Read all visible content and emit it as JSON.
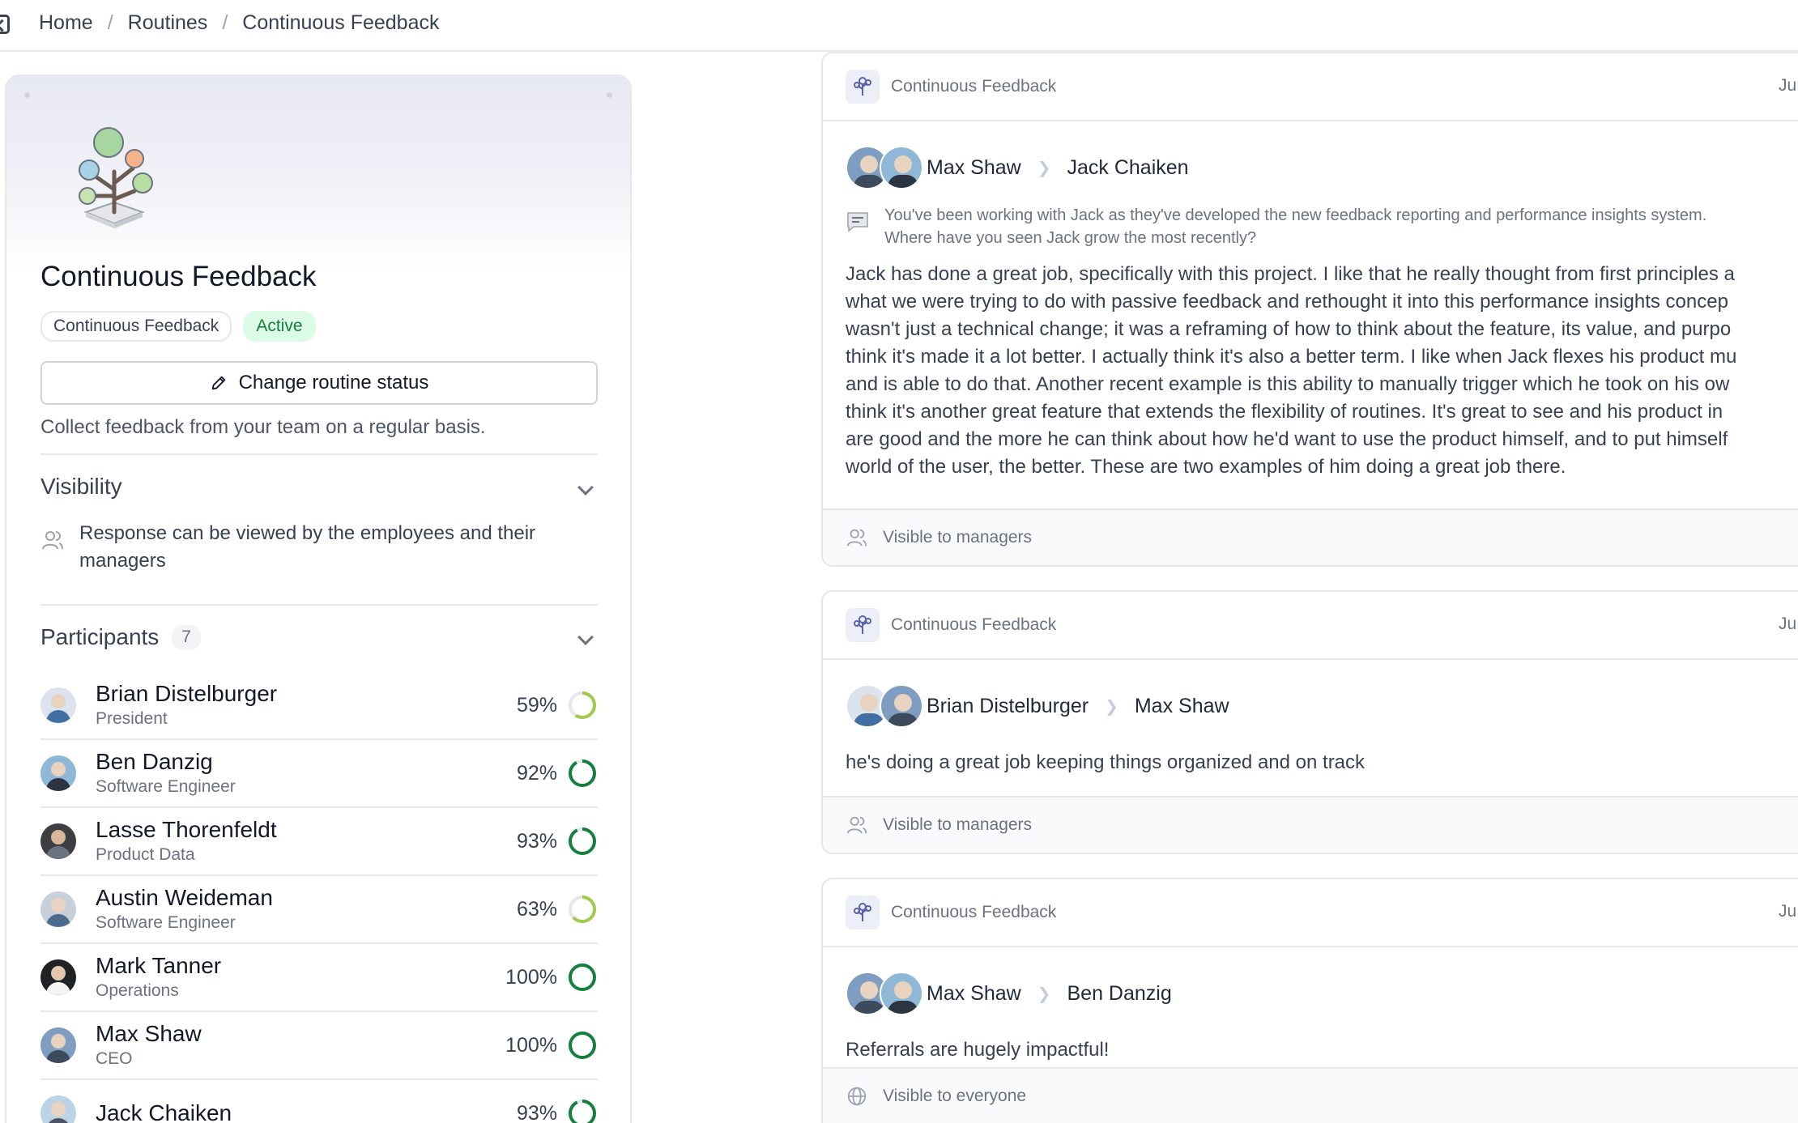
{
  "breadcrumb": {
    "items": [
      "Home",
      "Routines",
      "Continuous Feedback"
    ],
    "separator": "/"
  },
  "routine": {
    "title": "Continuous Feedback",
    "tags": [
      "Continuous Feedback",
      "Active"
    ],
    "change_status_label": "Change routine status",
    "description": "Collect feedback from your team on a regular basis."
  },
  "visibility": {
    "title": "Visibility",
    "text": "Response can be viewed by the employees and their managers"
  },
  "participants": {
    "title": "Participants",
    "count": "7",
    "items": [
      {
        "name": "Brian Distelburger",
        "role": "President",
        "percent": "59%",
        "completion": 0.59
      },
      {
        "name": "Ben Danzig",
        "role": "Software Engineer",
        "percent": "92%",
        "completion": 0.92
      },
      {
        "name": "Lasse Thorenfeldt",
        "role": "Product Data",
        "percent": "93%",
        "completion": 0.93
      },
      {
        "name": "Austin Weideman",
        "role": "Software Engineer",
        "percent": "63%",
        "completion": 0.63
      },
      {
        "name": "Mark Tanner",
        "role": "Operations",
        "percent": "100%",
        "completion": 1.0
      },
      {
        "name": "Max Shaw",
        "role": "CEO",
        "percent": "100%",
        "completion": 1.0
      },
      {
        "name": "Jack Chaiken",
        "role": "",
        "percent": "93%",
        "completion": 0.93
      }
    ]
  },
  "feed": [
    {
      "routine": "Continuous Feedback",
      "date": "Ju",
      "from": "Max Shaw",
      "to": "Jack Chaiken",
      "question": "You've been working with Jack as they've developed the new feedback reporting and performance insights system.\nWhere have you seen Jack grow the most recently?",
      "answer": "Jack has done a great job, specifically with this project. I like that he really thought from first principles a\nwhat we were trying to do with passive feedback and rethought it into this performance insights concep\nwasn't just a technical change; it was a reframing of how to think about the feature, its value, and purpo\nthink it's made it a lot better. I actually think it's also a better term. I like when Jack flexes his product mu\nand is able to do that. Another recent example is this ability to manually trigger which he took on his ow\nthink it's another great feature that extends the flexibility of routines. It's great to see and his product in\nare good and the more he can think about how he'd want to use the product himself, and to put himself\nworld of the user, the better. These are two examples of him doing a great job there.",
      "visibility": "Visible to managers"
    },
    {
      "routine": "Continuous Feedback",
      "date": "Ju",
      "from": "Brian Distelburger",
      "to": "Max Shaw",
      "answer": "he's doing a great job keeping things organized and on track",
      "visibility": "Visible to managers"
    },
    {
      "routine": "Continuous Feedback",
      "date": "Ju",
      "from": "Max Shaw",
      "to": "Ben Danzig",
      "answer": "Referrals are hugely impactful!",
      "visibility": "Visible to everyone"
    }
  ],
  "colors": {
    "ring_full": "#15803d",
    "ring_partial": "#a3c94a",
    "ring_track": "#e5e7eb",
    "active_tag_bg": "#dcfce7",
    "active_tag_text": "#15803d"
  },
  "icons": [
    "panel-toggle-icon",
    "tree-logo-icon",
    "pencil-icon",
    "chevron-down-icon",
    "people-icon",
    "question-icon",
    "routine-tree-icon",
    "arrow-right-icon",
    "globe-icon"
  ]
}
